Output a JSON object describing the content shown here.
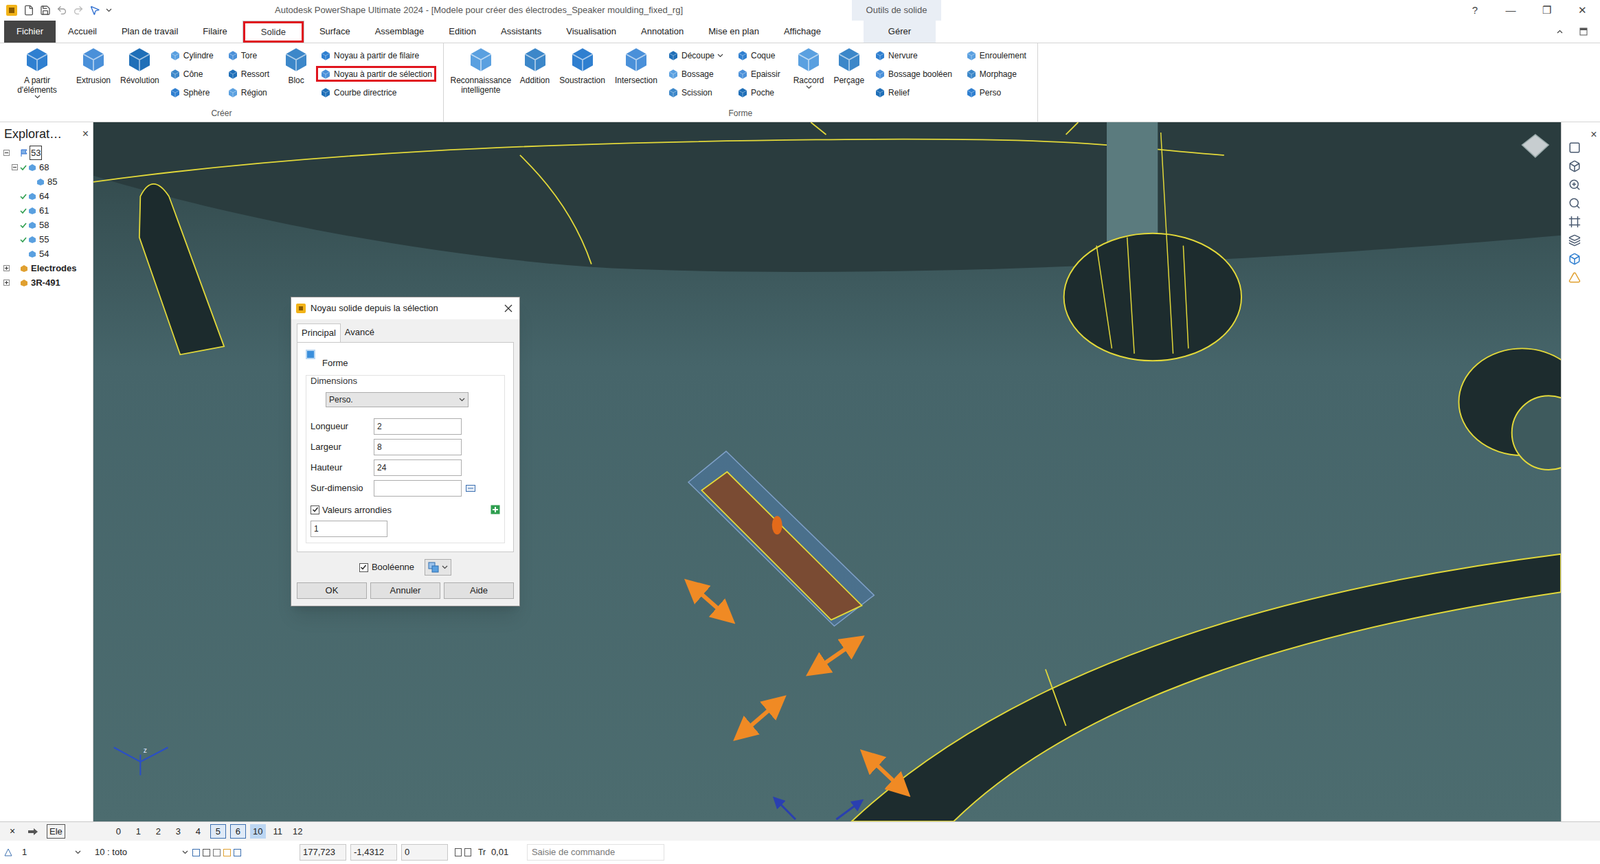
{
  "window": {
    "title": "Autodesk PowerShape Ultimate 2024 - [Modele pour créer des électrodes_Speaker moulding_fixed_rg]",
    "context_group": "Outils de solide",
    "controls": [
      "?",
      "—",
      "❐",
      "✕"
    ]
  },
  "tabs": [
    {
      "label": "Fichier",
      "selected": false,
      "highlighted": false,
      "kind": "file"
    },
    {
      "label": "Accueil",
      "selected": false,
      "highlighted": false,
      "kind": "tab"
    },
    {
      "label": "Plan de travail",
      "selected": false,
      "highlighted": false,
      "kind": "tab"
    },
    {
      "label": "Filaire",
      "selected": false,
      "highlighted": false,
      "kind": "tab"
    },
    {
      "label": "Solide",
      "selected": true,
      "highlighted": true,
      "kind": "tab"
    },
    {
      "label": "Surface",
      "selected": false,
      "highlighted": false,
      "kind": "tab"
    },
    {
      "label": "Assemblage",
      "selected": false,
      "highlighted": false,
      "kind": "tab"
    },
    {
      "label": "Edition",
      "selected": false,
      "highlighted": false,
      "kind": "tab"
    },
    {
      "label": "Assistants",
      "selected": false,
      "highlighted": false,
      "kind": "tab"
    },
    {
      "label": "Visualisation",
      "selected": false,
      "highlighted": false,
      "kind": "tab"
    },
    {
      "label": "Annotation",
      "selected": false,
      "highlighted": false,
      "kind": "tab"
    },
    {
      "label": "Mise en plan",
      "selected": false,
      "highlighted": false,
      "kind": "tab"
    },
    {
      "label": "Affichage",
      "selected": false,
      "highlighted": false,
      "kind": "tab"
    },
    {
      "label": "Gérer",
      "selected": false,
      "highlighted": false,
      "kind": "context"
    }
  ],
  "groups": [
    {
      "label": "Créer",
      "columns": [
        {
          "kind": "large",
          "items": [
            {
              "label": "A partir d'éléments",
              "dropdown": true,
              "highlighted": false
            }
          ]
        },
        {
          "kind": "large",
          "items": [
            {
              "label": "Extrusion",
              "dropdown": false,
              "highlighted": false
            }
          ]
        },
        {
          "kind": "large",
          "items": [
            {
              "label": "Révolution",
              "dropdown": false,
              "highlighted": false
            }
          ]
        },
        {
          "kind": "small",
          "items": [
            {
              "label": "Cylindre",
              "dropdown": false,
              "highlighted": false
            },
            {
              "label": "Cône",
              "dropdown": false,
              "highlighted": false
            },
            {
              "label": "Sphère",
              "dropdown": false,
              "highlighted": false
            }
          ]
        },
        {
          "kind": "small",
          "items": [
            {
              "label": "Tore",
              "dropdown": false,
              "highlighted": false
            },
            {
              "label": "Ressort",
              "dropdown": false,
              "highlighted": false
            },
            {
              "label": "Région",
              "dropdown": false,
              "highlighted": false
            }
          ]
        },
        {
          "kind": "large",
          "items": [
            {
              "label": "Bloc",
              "dropdown": false,
              "highlighted": false
            }
          ]
        },
        {
          "kind": "small",
          "items": [
            {
              "label": "Noyau à partir de filaire",
              "dropdown": false,
              "highlighted": false
            },
            {
              "label": "Noyau à partir de sélection",
              "dropdown": false,
              "highlighted": true
            },
            {
              "label": "Courbe directrice",
              "dropdown": false,
              "highlighted": false
            }
          ]
        }
      ]
    },
    {
      "label": "Forme",
      "columns": [
        {
          "kind": "large",
          "items": [
            {
              "label": "Reconnaissance intelligente",
              "dropdown": false,
              "highlighted": false
            }
          ]
        },
        {
          "kind": "large",
          "items": [
            {
              "label": "Addition",
              "dropdown": false,
              "highlighted": false
            }
          ]
        },
        {
          "kind": "large",
          "items": [
            {
              "label": "Soustraction",
              "dropdown": false,
              "highlighted": false
            }
          ]
        },
        {
          "kind": "large",
          "items": [
            {
              "label": "Intersection",
              "dropdown": false,
              "highlighted": false
            }
          ]
        },
        {
          "kind": "small",
          "items": [
            {
              "label": "Découpe",
              "dropdown": true,
              "highlighted": false
            },
            {
              "label": "Bossage",
              "dropdown": false,
              "highlighted": false
            },
            {
              "label": "Scission",
              "dropdown": false,
              "highlighted": false
            }
          ]
        },
        {
          "kind": "small",
          "items": [
            {
              "label": "Coque",
              "dropdown": false,
              "highlighted": false
            },
            {
              "label": "Epaissir",
              "dropdown": false,
              "highlighted": false
            },
            {
              "label": "Poche",
              "dropdown": false,
              "highlighted": false
            }
          ]
        },
        {
          "kind": "large",
          "items": [
            {
              "label": "Raccord",
              "dropdown": true,
              "highlighted": false
            }
          ]
        },
        {
          "kind": "large",
          "items": [
            {
              "label": "Perçage",
              "dropdown": false,
              "highlighted": false
            }
          ]
        },
        {
          "kind": "small",
          "items": [
            {
              "label": "Nervure",
              "dropdown": false,
              "highlighted": false
            },
            {
              "label": "Bossage booléen",
              "dropdown": false,
              "highlighted": false
            },
            {
              "label": "Relief",
              "dropdown": false,
              "highlighted": false
            }
          ]
        },
        {
          "kind": "small",
          "items": [
            {
              "label": "Enroulement",
              "dropdown": false,
              "highlighted": false
            },
            {
              "label": "Morphage",
              "dropdown": false,
              "highlighted": false
            },
            {
              "label": "Perso",
              "dropdown": false,
              "highlighted": false
            }
          ]
        }
      ]
    }
  ],
  "explorer": {
    "title": "Explorat…",
    "close": "×",
    "items": [
      {
        "label": "53",
        "level": 0,
        "expandable": true,
        "expanded": true,
        "checked": false,
        "selected": true,
        "kind": "root"
      },
      {
        "label": "68",
        "level": 1,
        "expandable": true,
        "expanded": true,
        "checked": true,
        "selected": false,
        "kind": "item"
      },
      {
        "label": "85",
        "level": 2,
        "expandable": false,
        "expanded": false,
        "checked": false,
        "selected": false,
        "kind": "item"
      },
      {
        "label": "64",
        "level": 1,
        "expandable": false,
        "expanded": false,
        "checked": true,
        "selected": false,
        "kind": "item"
      },
      {
        "label": "61",
        "level": 1,
        "expandable": false,
        "expanded": false,
        "checked": true,
        "selected": false,
        "kind": "item"
      },
      {
        "label": "58",
        "level": 1,
        "expandable": false,
        "expanded": false,
        "checked": true,
        "selected": false,
        "kind": "item"
      },
      {
        "label": "55",
        "level": 1,
        "expandable": false,
        "expanded": false,
        "checked": true,
        "selected": false,
        "kind": "item"
      },
      {
        "label": "54",
        "level": 1,
        "expandable": false,
        "expanded": false,
        "checked": false,
        "selected": false,
        "kind": "item"
      },
      {
        "label": "Electrodes",
        "level": 0,
        "expandable": true,
        "expanded": false,
        "checked": false,
        "selected": false,
        "kind": "group"
      },
      {
        "label": "3R-491",
        "level": 0,
        "expandable": true,
        "expanded": false,
        "checked": false,
        "selected": false,
        "kind": "group"
      }
    ]
  },
  "right_panel": {
    "close": "×"
  },
  "viewport": {
    "axis_label": "z"
  },
  "dialog": {
    "title": "Noyau solide depuis la sélection",
    "tabs": [
      {
        "label": "Principal",
        "selected": true
      },
      {
        "label": "Avancé",
        "selected": false
      }
    ],
    "shape_label": "Forme",
    "dimensions_label": "Dimensions",
    "preset": "Perso.",
    "fields": [
      {
        "label": "Longueur",
        "value": "2"
      },
      {
        "label": "Largeur",
        "value": "8"
      },
      {
        "label": "Hauteur",
        "value": "24"
      }
    ],
    "oversize": {
      "label": "Sur-dimensio",
      "value": ""
    },
    "rounded": {
      "label": "Valeurs arrondies",
      "checked": true,
      "value": "1"
    },
    "boolean": {
      "label": "Booléenne",
      "checked": true
    },
    "buttons": [
      "OK",
      "Annuler",
      "Aide"
    ]
  },
  "levels_bar": {
    "close": "×",
    "layer_button": "Ele",
    "levels": [
      {
        "label": "0",
        "selected": false,
        "current": false
      },
      {
        "label": "1",
        "selected": false,
        "current": false
      },
      {
        "label": "2",
        "selected": false,
        "current": false
      },
      {
        "label": "3",
        "selected": false,
        "current": false
      },
      {
        "label": "4",
        "selected": false,
        "current": false
      },
      {
        "label": "5",
        "selected": true,
        "current": false
      },
      {
        "label": "6",
        "selected": true,
        "current": false
      },
      {
        "label": "10",
        "selected": true,
        "current": true
      },
      {
        "label": "11",
        "selected": false,
        "current": false
      },
      {
        "label": "12",
        "selected": false,
        "current": false
      }
    ]
  },
  "status_bar": {
    "level": "1",
    "workplane": "10 : toto",
    "coords": [
      "177,723",
      "-1,4312",
      "0"
    ],
    "tolerance_label": "Tr",
    "tolerance": "0,01",
    "command_placeholder": "Saisie de commande"
  }
}
